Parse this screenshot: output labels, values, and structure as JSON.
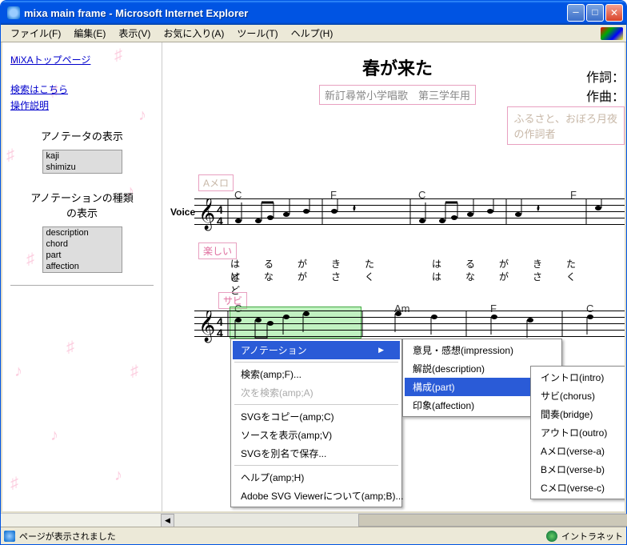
{
  "window": {
    "title": "mixa main frame - Microsoft Internet Explorer"
  },
  "menubar": {
    "file": "ファイル(F)",
    "edit": "編集(E)",
    "view": "表示(V)",
    "favorites": "お気に入り(A)",
    "tools": "ツール(T)",
    "help": "ヘルプ(H)"
  },
  "sidebar": {
    "top_link": "MiXAトップページ",
    "search_link": "検索はこちら",
    "help_link": "操作説明",
    "annotator_display": "アノテータの表示",
    "annotators": [
      "kaji",
      "shimizu"
    ],
    "annotation_types_title_l1": "アノテーションの種類",
    "annotation_types_title_l2": "の表示",
    "annotation_types": [
      "description",
      "chord",
      "part",
      "affection"
    ]
  },
  "score": {
    "title": "春が来た",
    "subtitle": "新訂尋常小学唱歌　第三学年用",
    "credit_lyric": "作詞：",
    "credit_music": "作曲：",
    "composer_note": "ふるさと、おぼろ月夜",
    "composer_note2": "の作詞者",
    "voice_label": "Voice",
    "parts": {
      "amelo": "Aメロ",
      "sabi": "サビ"
    },
    "affect": "楽しい",
    "chords1": [
      "C",
      "F",
      "C",
      "F"
    ],
    "chords2": [
      "C",
      "Am",
      "F",
      "C"
    ],
    "lyrics1_top": [
      "は",
      "る",
      "が",
      "き",
      "た",
      "",
      "は",
      "る",
      "が",
      "き",
      "た",
      "",
      "ど"
    ],
    "lyrics1_bot": [
      "は",
      "な",
      "が",
      "さ",
      "く",
      "",
      "は",
      "な",
      "が",
      "さ",
      "く",
      "",
      "ど"
    ]
  },
  "context_menu": {
    "annotation": "アノテーション",
    "search": "検索(amp;F)...",
    "search_next": "次を検索(amp;A)",
    "svg_copy": "SVGをコピー(amp;C)",
    "view_source": "ソースを表示(amp;V)",
    "svg_saveas": "SVGを別名で保存...",
    "help": "ヘルプ(amp;H)",
    "about": "Adobe SVG Viewerについて(amp;B)..."
  },
  "submenu1": {
    "impression": "意見・感想(impression)",
    "description": "解説(description)",
    "part": "構成(part)",
    "affection": "印象(affection)"
  },
  "submenu2": {
    "intro": "イントロ(intro)",
    "chorus": "サビ(chorus)",
    "bridge": "間奏(bridge)",
    "outro": "アウトロ(outro)",
    "verse_a": "Aメロ(verse-a)",
    "verse_b": "Bメロ(verse-b)",
    "verse_c": "Cメロ(verse-c)"
  },
  "statusbar": {
    "message": "ページが表示されました",
    "zone": "イントラネット"
  }
}
